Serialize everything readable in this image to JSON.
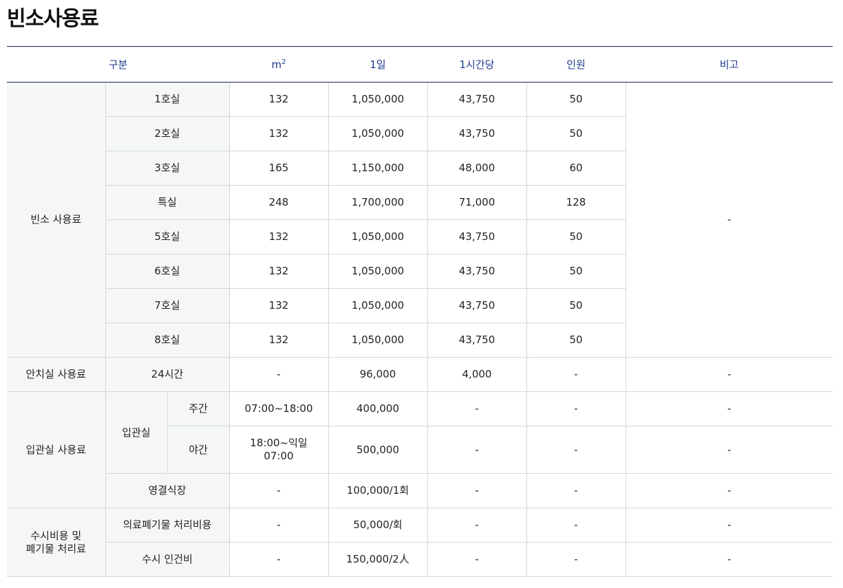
{
  "title": "빈소사용료",
  "headers": {
    "category": "구분",
    "area_base": "m",
    "area_exp": "2",
    "per_day": "1일",
    "per_hour": "1시간당",
    "capacity": "인원",
    "note": "비고"
  },
  "binso": {
    "label": "빈소 사용료",
    "note": "-",
    "rooms": [
      {
        "name": "1호실",
        "area": "132",
        "day": "1,050,000",
        "hour": "43,750",
        "people": "50"
      },
      {
        "name": "2호실",
        "area": "132",
        "day": "1,050,000",
        "hour": "43,750",
        "people": "50"
      },
      {
        "name": "3호실",
        "area": "165",
        "day": "1,150,000",
        "hour": "48,000",
        "people": "60"
      },
      {
        "name": "특실",
        "area": "248",
        "day": "1,700,000",
        "hour": "71,000",
        "people": "128"
      },
      {
        "name": "5호실",
        "area": "132",
        "day": "1,050,000",
        "hour": "43,750",
        "people": "50"
      },
      {
        "name": "6호실",
        "area": "132",
        "day": "1,050,000",
        "hour": "43,750",
        "people": "50"
      },
      {
        "name": "7호실",
        "area": "132",
        "day": "1,050,000",
        "hour": "43,750",
        "people": "50"
      },
      {
        "name": "8호실",
        "area": "132",
        "day": "1,050,000",
        "hour": "43,750",
        "people": "50"
      }
    ]
  },
  "anchi": {
    "label": "안치실 사용료",
    "item": "24시간",
    "area": "-",
    "day": "96,000",
    "hour": "4,000",
    "people": "-",
    "note": "-"
  },
  "ipgwan": {
    "label": "입관실 사용료",
    "room": "입관실",
    "day_row": {
      "name": "주간",
      "time": "07:00~18:00",
      "fee": "400,000",
      "hour": "-",
      "people": "-",
      "note": "-"
    },
    "night_row": {
      "name": "야간",
      "time_line1": "18:00~익일",
      "time_line2": "07:00",
      "fee": "500,000",
      "hour": "-",
      "people": "-",
      "note": "-"
    },
    "farewell": {
      "name": "영결식장",
      "area": "-",
      "fee": "100,000/1회",
      "hour": "-",
      "people": "-",
      "note": "-"
    }
  },
  "susi": {
    "label_line1": "수시비용 및",
    "label_line2": "폐기물 처리료",
    "rows": [
      {
        "name": "의료폐기물 처리비용",
        "area": "-",
        "fee": "50,000/회",
        "hour": "-",
        "people": "-",
        "note": "-"
      },
      {
        "name": "수시 인건비",
        "area": "-",
        "fee": "150,000/2人",
        "hour": "-",
        "people": "-",
        "note": "-"
      }
    ]
  }
}
